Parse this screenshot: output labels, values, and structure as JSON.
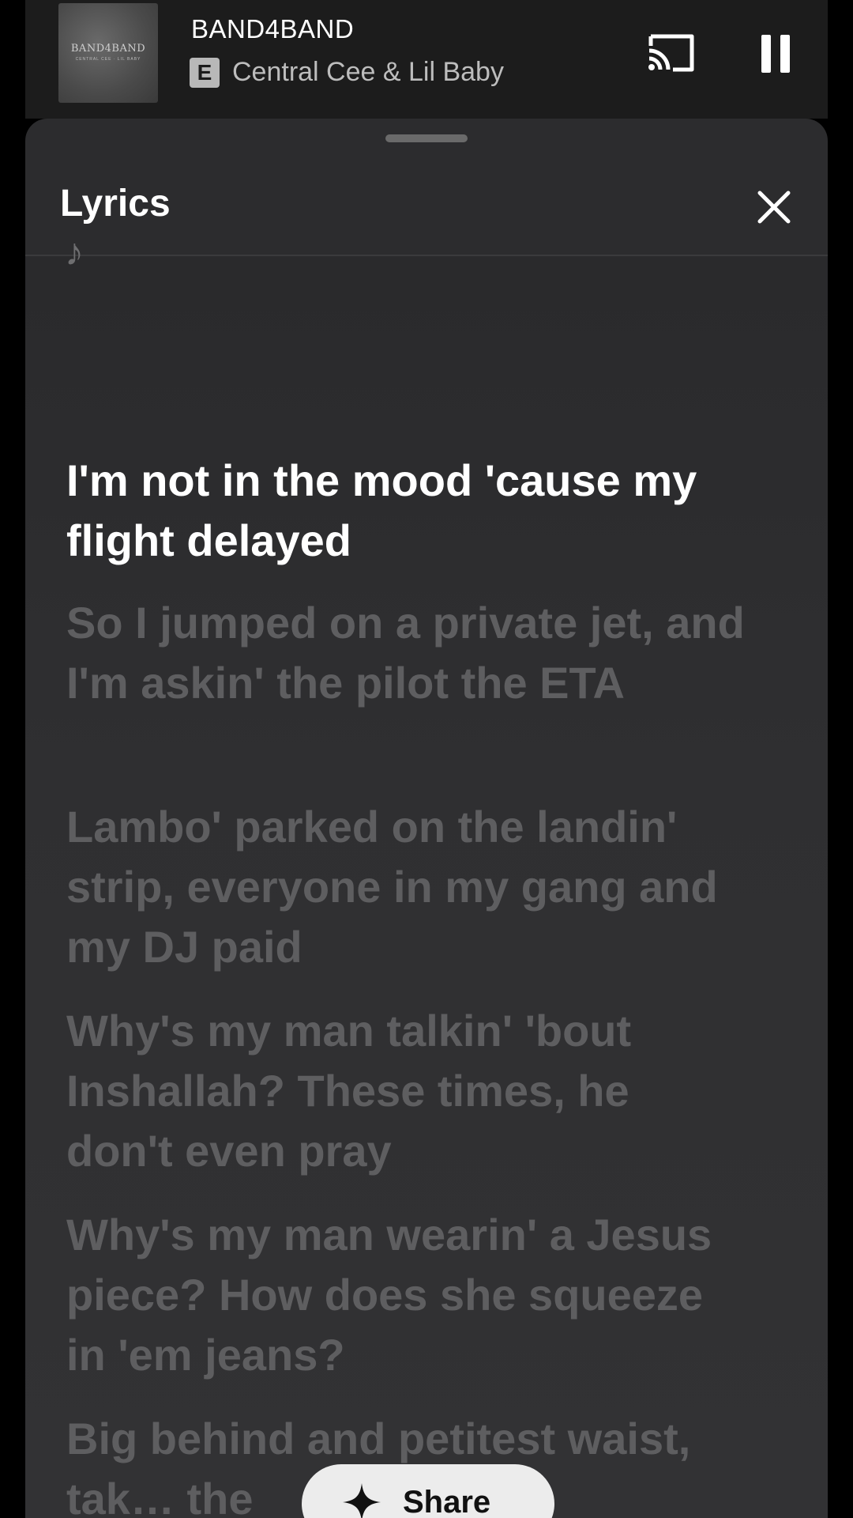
{
  "mini_player": {
    "album_art_title": "BAND4BAND",
    "album_art_subtitle": "CENTRAL CEE · LIL BABY",
    "track_title": "BAND4BAND",
    "explicit_badge": "E",
    "artist": "Central Cee & Lil Baby",
    "cast_icon": "cast-icon",
    "pause_icon": "pause-icon"
  },
  "sheet": {
    "title": "Lyrics",
    "close_icon": "close-icon"
  },
  "lyrics": {
    "music_note": "♪",
    "lines": [
      "I'm not in the mood 'cause my flight delayed",
      "So I jumped on a private jet, and I'm askin' the pilot the ETA",
      "Lambo' parked on the landin' strip, everyone in my gang and my DJ paid",
      "Why's my man talkin' 'bout Inshallah? These times, he don't even pray",
      "Why's my man wearin' a Jesus piece? How does she squeeze in 'em jeans?",
      "Big behind and petitest waist, tak… the"
    ],
    "active_index": 0
  },
  "share": {
    "icon": "sparkle-icon",
    "label": "Share"
  },
  "colors": {
    "sheet_bg": "#2c2c2e",
    "active_lyric": "#ffffff",
    "dim_lyric": "#5e5e60"
  }
}
